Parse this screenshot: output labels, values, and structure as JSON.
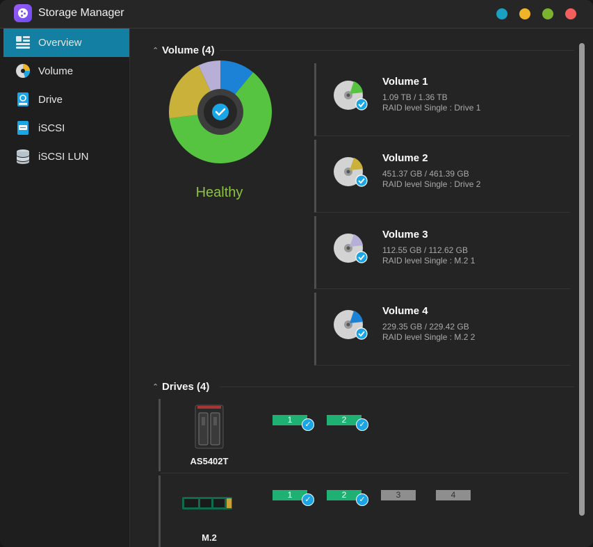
{
  "app": {
    "title": "Storage Manager"
  },
  "window_buttons": [
    {
      "name": "info",
      "color": "#1aa0c0"
    },
    {
      "name": "minimize",
      "color": "#f0b429"
    },
    {
      "name": "maximize",
      "color": "#7bb32e"
    },
    {
      "name": "close",
      "color": "#f25f5c"
    }
  ],
  "sidebar": {
    "items": [
      {
        "label": "Overview",
        "icon": "overview-icon",
        "active": true
      },
      {
        "label": "Volume",
        "icon": "volume-icon",
        "active": false
      },
      {
        "label": "Drive",
        "icon": "drive-icon",
        "active": false
      },
      {
        "label": "iSCSI",
        "icon": "iscsi-icon",
        "active": false
      },
      {
        "label": "iSCSI LUN",
        "icon": "iscsi-lun-icon",
        "active": false
      }
    ]
  },
  "volume_section": {
    "title": "Volume (4)",
    "status": "Healthy",
    "status_color": "#8ac43f",
    "donut": [
      {
        "volume": "Volume 1",
        "color": "#56c441",
        "share": 0.62
      },
      {
        "volume": "Volume 2",
        "color": "#c9b13a",
        "share": 0.2
      },
      {
        "volume": "Volume 3",
        "color": "#b7afd6",
        "share": 0.07
      },
      {
        "volume": "Volume 4",
        "color": "#1b82d6",
        "share": 0.11
      }
    ],
    "volumes": [
      {
        "name": "Volume 1",
        "capacity": "1.09 TB / 1.36 TB",
        "raid": "RAID level Single : Drive 1",
        "color": "#56c441"
      },
      {
        "name": "Volume 2",
        "capacity": "451.37 GB / 461.39 GB",
        "raid": "RAID level Single : Drive 2",
        "color": "#c9b13a"
      },
      {
        "name": "Volume 3",
        "capacity": "112.55 GB / 112.62 GB",
        "raid": "RAID level Single : M.2 1",
        "color": "#b7afd6"
      },
      {
        "name": "Volume 4",
        "capacity": "229.35 GB / 229.42 GB",
        "raid": "RAID level Single : M.2 2",
        "color": "#1b82d6"
      }
    ]
  },
  "drives_section": {
    "title": "Drives (4)",
    "groups": [
      {
        "label": "AS5402T",
        "icon": "nas-device-icon",
        "slots": [
          {
            "number": "1",
            "used": true
          },
          {
            "number": "2",
            "used": true
          }
        ]
      },
      {
        "label": "M.2",
        "icon": "m2-ssd-icon",
        "slots": [
          {
            "number": "1",
            "used": true
          },
          {
            "number": "2",
            "used": true
          },
          {
            "number": "3",
            "used": false
          },
          {
            "number": "4",
            "used": false
          }
        ]
      }
    ]
  }
}
